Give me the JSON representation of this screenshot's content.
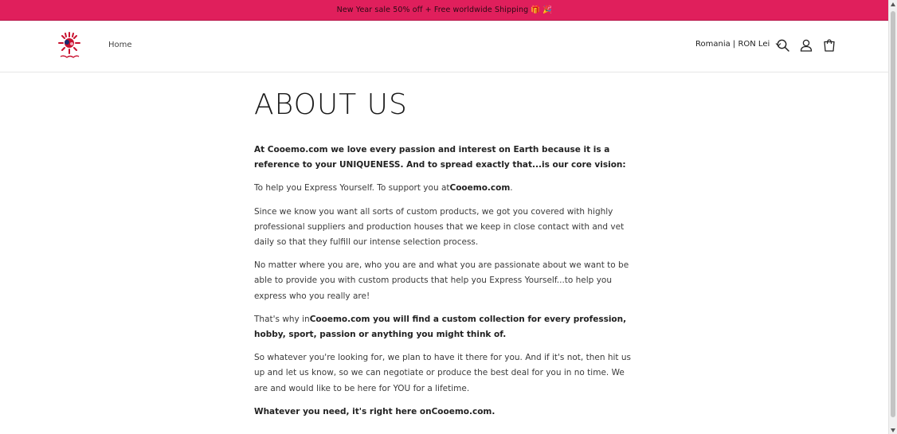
{
  "announcement": {
    "text": "New Year sale 50% off + Free worldwide Shipping 🎁 🎉"
  },
  "header": {
    "logo_alt": "Cooemo",
    "nav": [
      {
        "label": "Home"
      }
    ],
    "locale": "Romania | RON Lei",
    "icons": [
      "search-icon",
      "account-icon",
      "cart-icon"
    ]
  },
  "page": {
    "title": "ABOUT US",
    "p1": "At Cooemo.com we love every passion and interest on Earth because it is a reference to your UNIQUENESS. And to spread exactly that...is our core vision:",
    "p2_prefix": "To help you Express Yourself. To support you at",
    "p2_brand": "Cooemo.com",
    "p2_suffix": ".",
    "p3": "Since we know you want all sorts of custom products, we got you covered with highly professional suppliers and production houses that we keep in close contact with and vet daily so that they fulfill our intense selection process.",
    "p4": "No matter where you are, who you are and what you are passionate about we want to be able to provide you with custom products that help you Express Yourself...to help you express who you really are!",
    "p5_prefix": "That's why in",
    "p5_bold": "Cooemo.com you will find a custom collection for every profession, hobby, sport, passion or anything you might think of.",
    "p6": "So whatever you're looking for, we plan to have it there for you. And if it's not, then hit us up and let us know, so we can negotiate or produce the best deal for you in no time. We are and would like to be here for YOU for a lifetime.",
    "p7": "Whatever you need, it's right here onCooemo.com."
  },
  "colors": {
    "announcement_bg": "#e01f5c",
    "logo_red": "#c8102e"
  }
}
